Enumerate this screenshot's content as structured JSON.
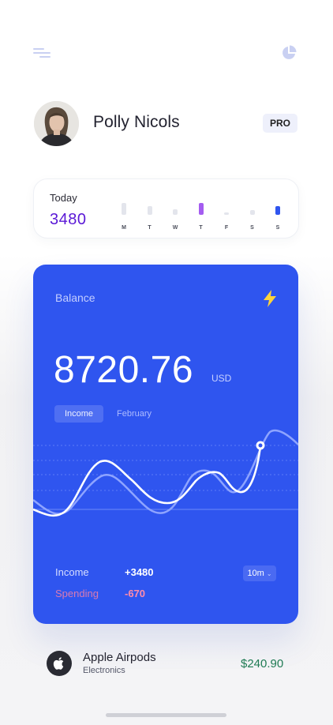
{
  "header": {
    "menu_icon": "menu-lines-icon",
    "stats_icon": "pie-chart-icon",
    "icon_color": "#c9d0f2"
  },
  "profile": {
    "name": "Polly Nicols",
    "badge": "PRO"
  },
  "today": {
    "label": "Today",
    "value": "3480",
    "accent": "#5a18d6",
    "days": [
      "M",
      "T",
      "W",
      "T",
      "F",
      "S",
      "S"
    ],
    "levels": [
      0.55,
      0.38,
      0.25,
      0.55,
      0.12,
      0.22,
      0.4
    ],
    "highlight": [
      null,
      null,
      null,
      "#a45cf0",
      null,
      null,
      "#2f55ef"
    ]
  },
  "balance": {
    "label": "Balance",
    "amount": "8720.76",
    "currency": "USD",
    "card_color": "#2f55ef",
    "bolt_icon": "lightning-bolt-icon",
    "bolt_color": "#ffd43b",
    "tabs": {
      "active": "Income",
      "inactive": "February"
    },
    "summary": {
      "income_label": "Income",
      "income_value": "+3480",
      "spending_label": "Spending",
      "spending_value": "-670"
    },
    "range": "10m"
  },
  "transaction": {
    "icon": "apple-logo-icon",
    "title": "Apple Airpods",
    "category": "Electronics",
    "amount": "$240.90",
    "amount_color": "#1f7b53"
  }
}
